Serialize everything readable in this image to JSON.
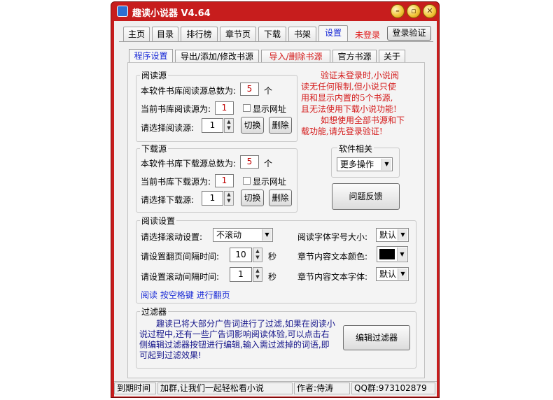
{
  "window": {
    "title": "趣读小说器 V4.64"
  },
  "main_tabs": [
    "主页",
    "目录",
    "排行榜",
    "章节页",
    "下载",
    "书架",
    "设置"
  ],
  "login_status": "未登录",
  "login_button": "登录验证",
  "sub_tabs": [
    "程序设置",
    "导出/添加/修改书源",
    "导入/删除书源",
    "官方书源",
    "关于"
  ],
  "read_source": {
    "title": "阅读源",
    "total_label": "本软件书库阅读源总数为:",
    "total_value": "5",
    "total_unit": "个",
    "current_label": "当前书库阅读源为:",
    "current_value": "1",
    "show_url_label": "显示网址",
    "select_label": "请选择阅读源:",
    "select_value": "1",
    "switch_button": "切换",
    "delete_button": "删除"
  },
  "notice_lines": [
    "验证未登录时,小说阅",
    "读无任何限制,但小说只使",
    "用和显示内置的5个书源,",
    "且无法使用下载小说功能!",
    "如想使用全部书源和下",
    "载功能,请先登录验证!"
  ],
  "download_source": {
    "title": "下载源",
    "total_label": "本软件书库下载源总数为:",
    "total_value": "5",
    "total_unit": "个",
    "current_label": "当前书库下载源为:",
    "current_value": "1",
    "show_url_label": "显示网址",
    "select_label": "请选择下载源:",
    "select_value": "1",
    "switch_button": "切换",
    "delete_button": "删除"
  },
  "software": {
    "title": "软件相关",
    "more_ops": "更多操作",
    "feedback_button": "问题反馈"
  },
  "reading_settings": {
    "title": "阅读设置",
    "scroll_label": "请选择滚动设置:",
    "scroll_value": "不滚动",
    "page_interval_label": "请设置翻页间隔时间:",
    "page_interval_value": "10",
    "scroll_interval_label": "请设置滚动间隔时间:",
    "scroll_interval_value": "1",
    "seconds_unit": "秒",
    "font_size_label": "阅读字体字号大小:",
    "font_size_value": "默认",
    "text_color_label": "章节内容文本颜色:",
    "text_color_value": "#000000",
    "font_label": "章节内容文本字体:",
    "font_value": "默认",
    "hint": "阅读 按空格键 进行翻页"
  },
  "filter": {
    "title": "过滤器",
    "text": "趣读已将大部分广告词进行了过滤,如果在阅读小说过程中,还有一些广告词影响阅读体验,可以点击右侧编辑过滤器按钮进行编辑,输入需过滤掉的词语,即可起到过滤效果!",
    "edit_button": "编辑过滤器"
  },
  "status_bar": {
    "expiry": "到期时间",
    "message": "加群,让我们一起轻松看小说",
    "author": "作者:侍涛",
    "qq": "QQ群:973102879"
  },
  "colors": {
    "title_bar": "#c71d1d",
    "accent_text": "#d41a1a",
    "link_text": "#1a2bd6"
  }
}
